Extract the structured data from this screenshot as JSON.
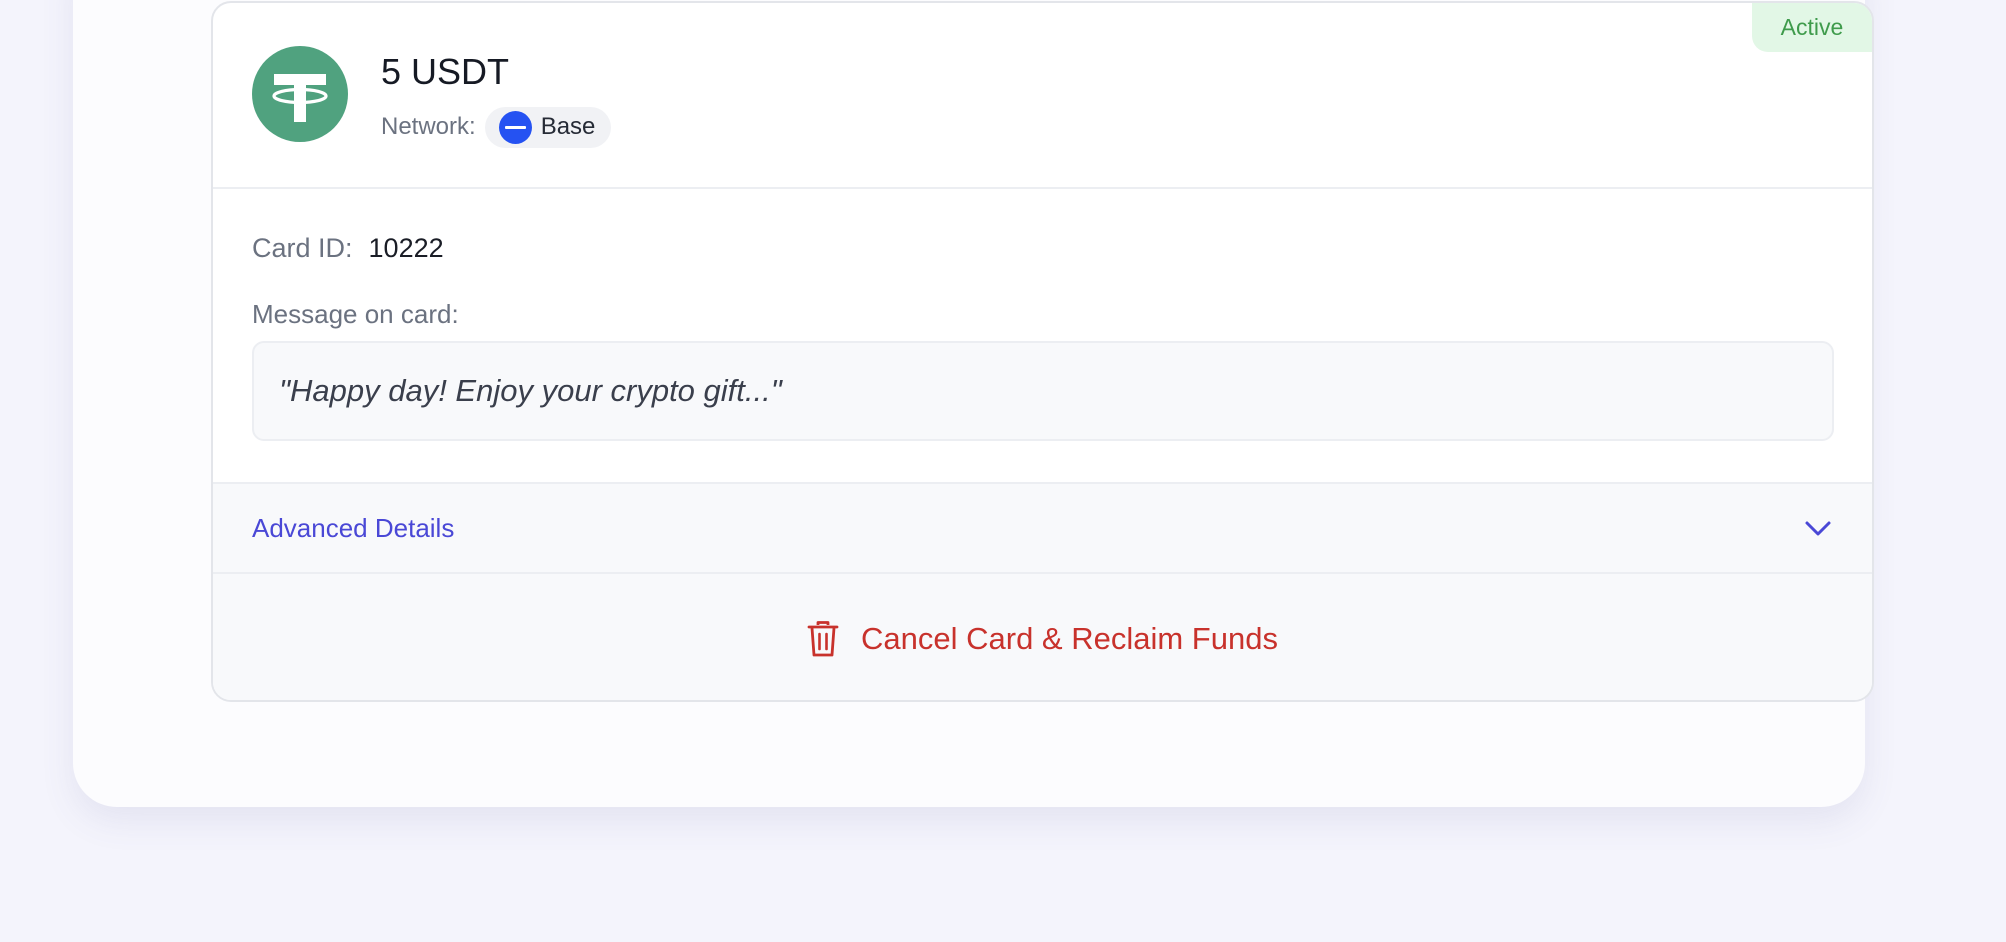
{
  "card": {
    "status": "Active",
    "amount": "5 USDT",
    "network_label": "Network:",
    "network_name": "Base",
    "card_id_label": "Card ID:",
    "card_id_value": "10222",
    "message_label": "Message on card:",
    "message_text": "\"Happy day! Enjoy your crypto gift...\"",
    "advanced_label": "Advanced Details",
    "cancel_label": "Cancel Card & Reclaim Funds"
  },
  "icons": {
    "token": "tether-usdt-icon",
    "network": "base-network-icon",
    "expand": "chevron-down-icon",
    "cancel": "trash-icon"
  },
  "colors": {
    "active_badge_bg": "#e2f7e6",
    "active_badge_text": "#3f9b4c",
    "tether_green": "#50a27f",
    "base_blue": "#2552f2",
    "link_purple": "#4a48d6",
    "danger_red": "#c8322c"
  }
}
